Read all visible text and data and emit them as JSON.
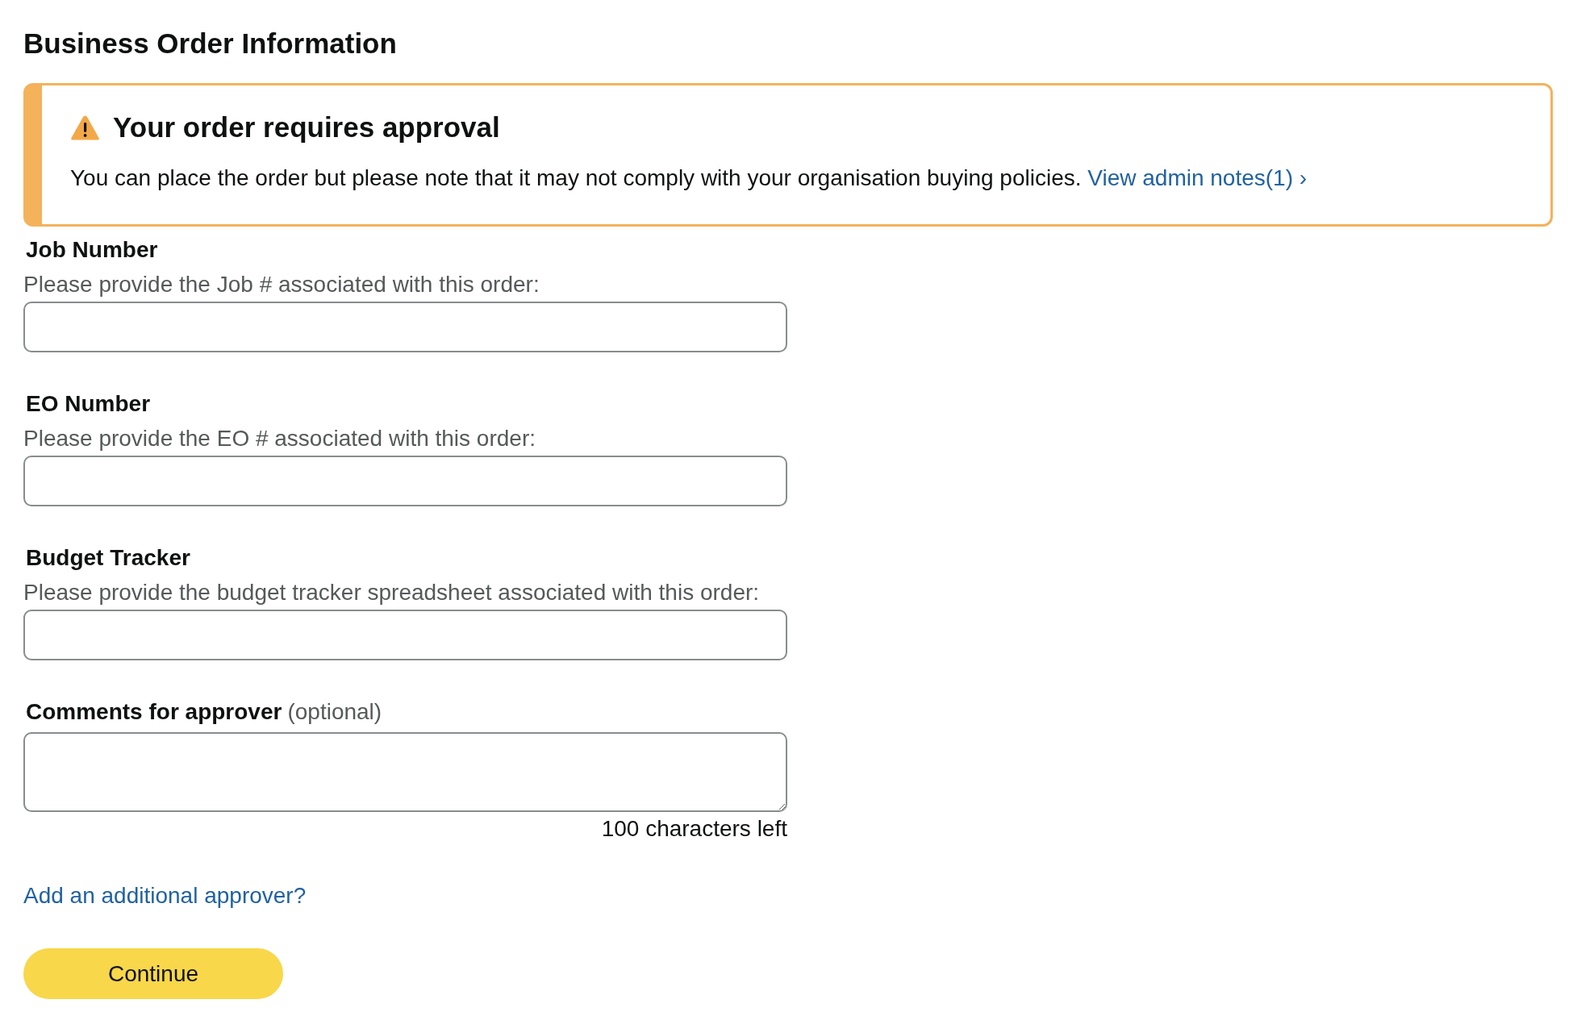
{
  "page": {
    "title": "Business Order Information"
  },
  "alert": {
    "kind": "warning",
    "heading": "Your order requires approval",
    "message": "You can place the order but please note that it may not comply with your organisation buying policies.",
    "link": "View admin notes(1) ›"
  },
  "fields": [
    {
      "kind": "text",
      "label": "Job Number",
      "description": "Please provide the Job # associated with this order:"
    },
    {
      "kind": "text",
      "label": "EO Number",
      "description": "Please provide the EO # associated with this order:"
    },
    {
      "kind": "text",
      "label": "Budget Tracker",
      "description": "Please provide the budget tracker spreadsheet associated with this order:"
    },
    {
      "kind": "textarea",
      "label": "Comments for approver",
      "note": "(optional)",
      "counter": "100 characters left"
    }
  ],
  "add_approver_link": "Add an additional approver?",
  "continue_button": "Continue"
}
